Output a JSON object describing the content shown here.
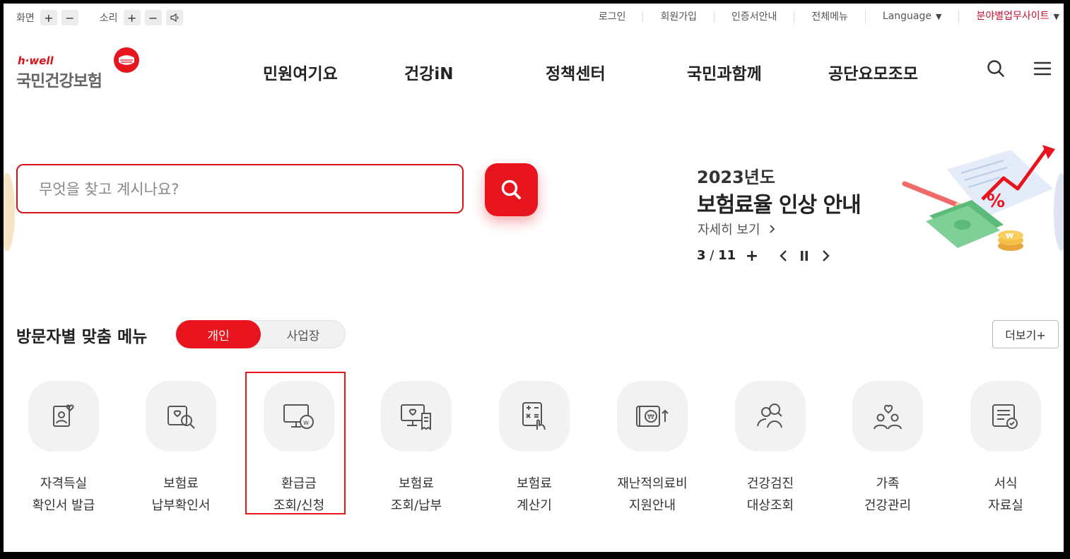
{
  "utility": {
    "screen_label": "화면",
    "sound_label": "소리",
    "plus": "+",
    "minus": "−",
    "links": [
      "로그인",
      "회원가입",
      "인증서안내",
      "전체메뉴"
    ],
    "language": "Language",
    "business_site": "분야별업무사이트"
  },
  "header": {
    "logo_tag": "h·well",
    "logo_name": "국민건강보험",
    "nav": [
      "민원여기요",
      "건강iN",
      "정책센터",
      "국민과함께",
      "공단요모조모"
    ]
  },
  "search": {
    "placeholder": "무엇을 찾고 계시나요?"
  },
  "banner": {
    "year": "2023년도",
    "title": "보험료율 인상 안내",
    "more": "자세히 보기",
    "current": "3",
    "separator": "/",
    "total": "11",
    "plus": "+"
  },
  "visitor_menu": {
    "title": "방문자별 맞춤 메뉴",
    "tab_personal": "개인",
    "tab_business": "사업장",
    "more": "더보기+",
    "items": [
      {
        "line1": "자격득실",
        "line2": "확인서 발급",
        "icon": "certificate-person-icon"
      },
      {
        "line1": "보험료",
        "line2": "납부확인서",
        "icon": "document-search-icon"
      },
      {
        "line1": "환급금",
        "line2": "조회/신청",
        "icon": "monitor-won-icon"
      },
      {
        "line1": "보험료",
        "line2": "조회/납부",
        "icon": "monitor-receipt-icon"
      },
      {
        "line1": "보험료",
        "line2": "계산기",
        "icon": "calculator-hand-icon"
      },
      {
        "line1": "재난적의료비",
        "line2": "지원안내",
        "icon": "wallet-won-up-icon"
      },
      {
        "line1": "건강검진",
        "line2": "대상조회",
        "icon": "people-search-icon"
      },
      {
        "line1": "가족",
        "line2": "건강관리",
        "icon": "family-heart-icon"
      },
      {
        "line1": "서식",
        "line2": "자료실",
        "icon": "form-document-icon"
      }
    ]
  },
  "colors": {
    "brand_red": "#e8141e",
    "text_dark": "#222222",
    "icon_bg": "#f2f2f2"
  }
}
